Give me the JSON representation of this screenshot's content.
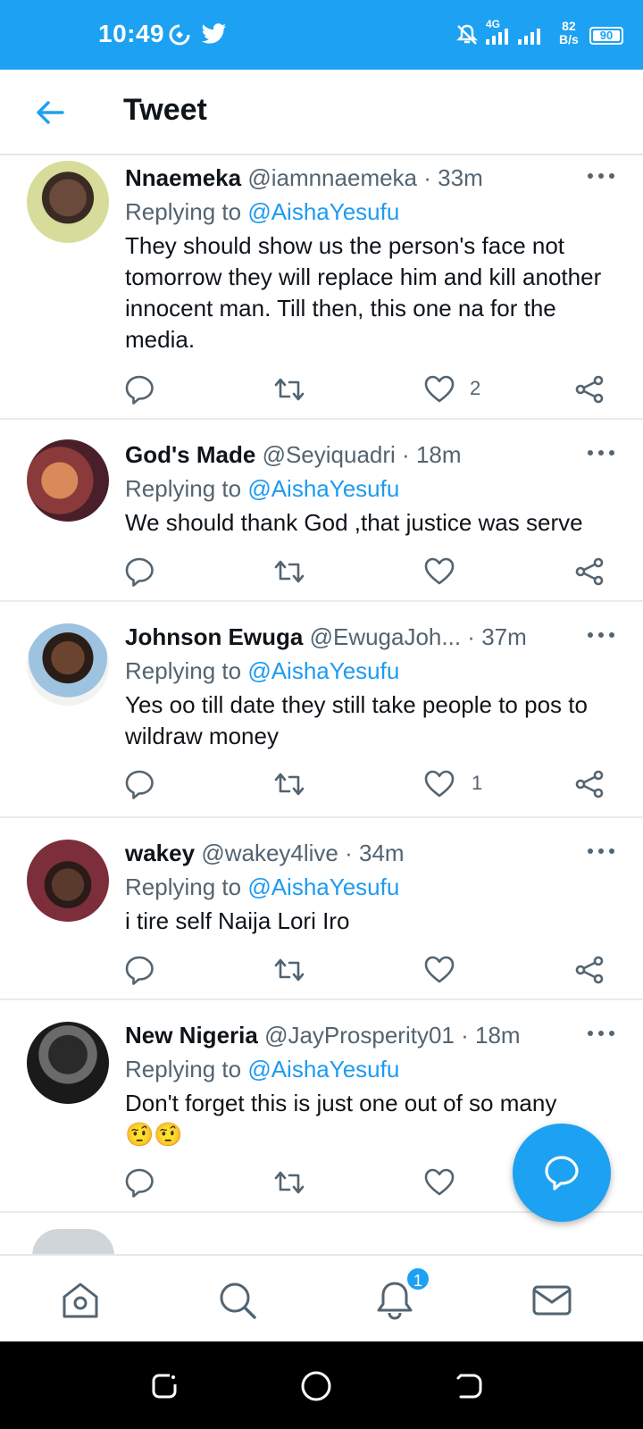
{
  "status_bar": {
    "time": "10:49",
    "network": "4G",
    "speed_value": "82",
    "speed_unit": "B/s",
    "battery": "90"
  },
  "header": {
    "title": "Tweet"
  },
  "reply_prefix": "Replying to",
  "tweets": [
    {
      "name": "Nnaemeka",
      "handle": "@iamnnaemeka",
      "time": "33m",
      "reply_to": "@AishaYesufu",
      "text": "They should show us the person's face not tomorrow they will replace him and kill another innocent man. Till then, this one na for the media.",
      "likes": "2"
    },
    {
      "name": "God's Made",
      "handle": "@Seyiquadri",
      "time": "18m",
      "reply_to": "@AishaYesufu",
      "text": "We should thank God ,that justice was serve",
      "likes": ""
    },
    {
      "name": "Johnson Ewuga",
      "handle": "@EwugaJoh...",
      "time": "37m",
      "reply_to": "@AishaYesufu",
      "text": "Yes oo till date they still take people to pos to wildraw money",
      "likes": "1"
    },
    {
      "name": "wakey",
      "handle": "@wakey4live",
      "time": "34m",
      "reply_to": "@AishaYesufu",
      "text": "i tire self Naija Lori Iro",
      "likes": ""
    },
    {
      "name": "New Nigeria",
      "handle": "@JayProsperity01",
      "time": "18m",
      "reply_to": "@AishaYesufu",
      "text": "Don't forget this is just one out of so many",
      "emoji": "🤨🤨",
      "likes": ""
    }
  ],
  "bottom_nav": {
    "notification_badge": "1"
  },
  "colors": {
    "accent": "#1da1f2",
    "link": "#1d9bf0",
    "secondary_text": "#536471"
  },
  "icons": [
    "back-arrow-icon",
    "reply-icon",
    "retweet-icon",
    "like-icon",
    "share-icon",
    "more-icon",
    "home-icon",
    "search-icon",
    "bell-icon",
    "mail-icon",
    "compose-icon"
  ]
}
